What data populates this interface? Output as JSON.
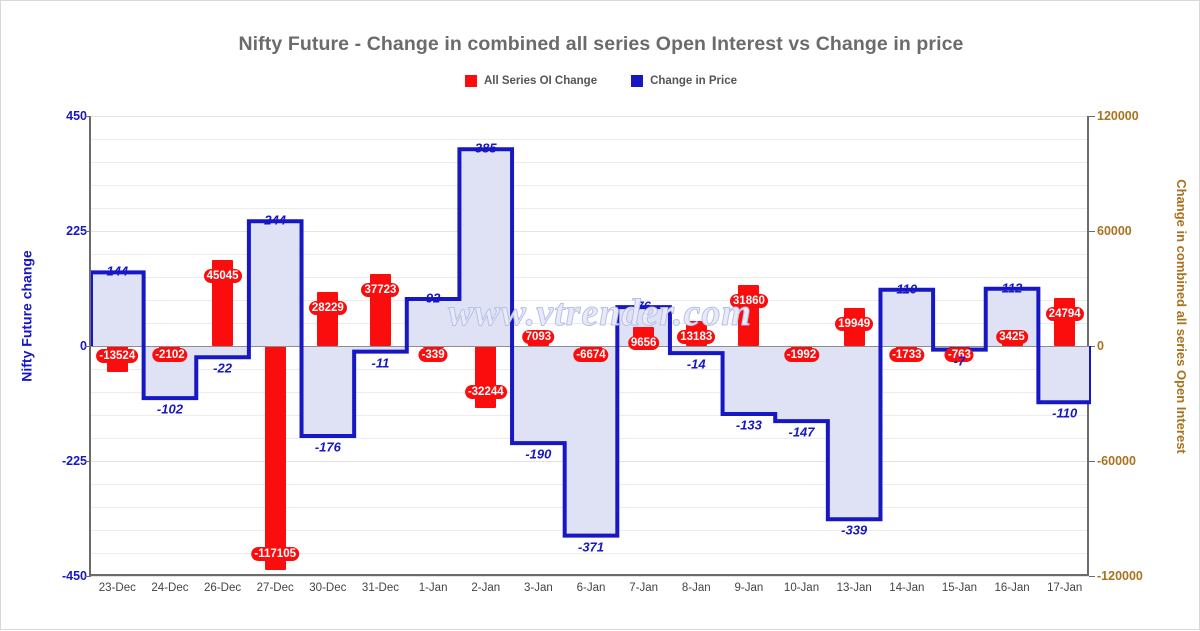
{
  "header": {
    "title": "Nifty Future - Change in combined all series Open Interest vs Change in price",
    "watermark": "www.vtrender.com"
  },
  "legend": {
    "items": [
      {
        "label": "All Series OI Change",
        "color": "#fb0d0d"
      },
      {
        "label": "Change in Price",
        "color": "#1717c4"
      }
    ]
  },
  "colors": {
    "bar": "#fb0d0d",
    "line": "#1717c4",
    "line_fill": "#dfe2f5",
    "left_axis": "#1717c4",
    "right_axis": "#a8721f",
    "title": "#6b6b6b"
  },
  "chart_data": {
    "type": "bar",
    "title": "Nifty Future - Change in combined all series Open Interest vs Change in price",
    "xlabel": "",
    "ylabel": "Nifty Future change",
    "y2label": "Change in combined all series Open Interest",
    "grid": true,
    "legend_position": "top-center",
    "ylim": [
      -450,
      450
    ],
    "y2lim": [
      -120000,
      120000
    ],
    "yticks": [
      "450",
      "225",
      "0",
      "-225",
      "-450"
    ],
    "y2ticks": [
      "120000",
      "60000",
      "0",
      "-60000",
      "-120000"
    ],
    "categories": [
      "23-Dec",
      "24-Dec",
      "26-Dec",
      "27-Dec",
      "30-Dec",
      "31-Dec",
      "1-Jan",
      "2-Jan",
      "3-Jan",
      "6-Jan",
      "7-Jan",
      "8-Jan",
      "9-Jan",
      "10-Jan",
      "13-Jan",
      "14-Jan",
      "15-Jan",
      "16-Jan",
      "17-Jan"
    ],
    "series": [
      {
        "name": "All Series OI Change",
        "type": "bar",
        "axis": "y2",
        "color": "#fb0d0d",
        "values": [
          -13524,
          -2102,
          45045,
          -117105,
          28229,
          37723,
          -339,
          -32244,
          7093,
          -6674,
          9656,
          13183,
          31860,
          -1992,
          19949,
          -1733,
          -763,
          3425,
          24794
        ],
        "labels": [
          "-13524",
          "-2102",
          "45045",
          "-117105",
          "28229",
          "37723",
          "-339",
          "-32244",
          "7093",
          "-6674",
          "9656",
          "13183",
          "31860",
          "-1992",
          "19949",
          "-1733",
          "-763",
          "3425",
          "24794"
        ]
      },
      {
        "name": "Change in Price",
        "type": "step-area",
        "axis": "y",
        "color": "#1717c4",
        "values": [
          144,
          -102,
          -22,
          244,
          -176,
          -11,
          92,
          385,
          -190,
          -371,
          76,
          -14,
          -133,
          -147,
          -339,
          110,
          -7,
          112,
          -110
        ],
        "labels": [
          "144",
          "-102",
          "-22",
          "244",
          "-176",
          "-11",
          "92",
          "385",
          "-190",
          "-371",
          "76",
          "-14",
          "-133",
          "-147",
          "-339",
          "110",
          "-7",
          "112",
          "-110"
        ]
      }
    ]
  }
}
